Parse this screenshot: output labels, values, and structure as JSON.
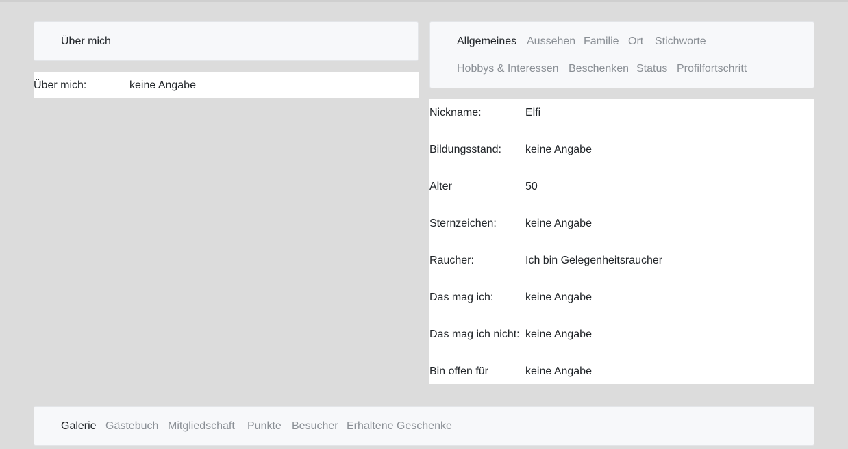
{
  "left": {
    "header_title": "Über mich",
    "row": {
      "label": "Über mich:",
      "value": "keine Angabe"
    }
  },
  "right": {
    "tabs_row1": [
      {
        "label": "Allgemeines",
        "active": true
      },
      {
        "label": "Aussehen",
        "active": false
      },
      {
        "label": "Familie",
        "active": false
      },
      {
        "label": "Ort",
        "active": false
      },
      {
        "label": "Stichworte",
        "active": false
      }
    ],
    "tabs_row2": [
      {
        "label": "Hobbys & Interessen",
        "active": false
      },
      {
        "label": "Beschenken",
        "active": false
      },
      {
        "label": "Status",
        "active": false
      },
      {
        "label": "Profilfortschritt",
        "active": false
      }
    ],
    "rows": [
      {
        "label": "Nickname:",
        "value": "Elfi"
      },
      {
        "label": "Bildungsstand:",
        "value": "keine Angabe"
      },
      {
        "label": "Alter",
        "value": "50"
      },
      {
        "label": "Sternzeichen:",
        "value": "keine Angabe"
      },
      {
        "label": "Raucher:",
        "value": "Ich bin Gelegenheitsraucher"
      },
      {
        "label": "Das mag ich:",
        "value": "keine Angabe"
      },
      {
        "label": "Das mag ich nicht:",
        "value": "keine Angabe"
      },
      {
        "label": "Bin offen für",
        "value": "keine Angabe"
      }
    ]
  },
  "bottom": {
    "tabs": [
      {
        "label": "Galerie",
        "active": true
      },
      {
        "label": "Gästebuch",
        "active": false
      },
      {
        "label": "Mitgliedschaft",
        "active": false
      },
      {
        "label": "Punkte",
        "active": false
      },
      {
        "label": "Besucher",
        "active": false
      },
      {
        "label": "Erhaltene Geschenke",
        "active": false
      }
    ]
  }
}
